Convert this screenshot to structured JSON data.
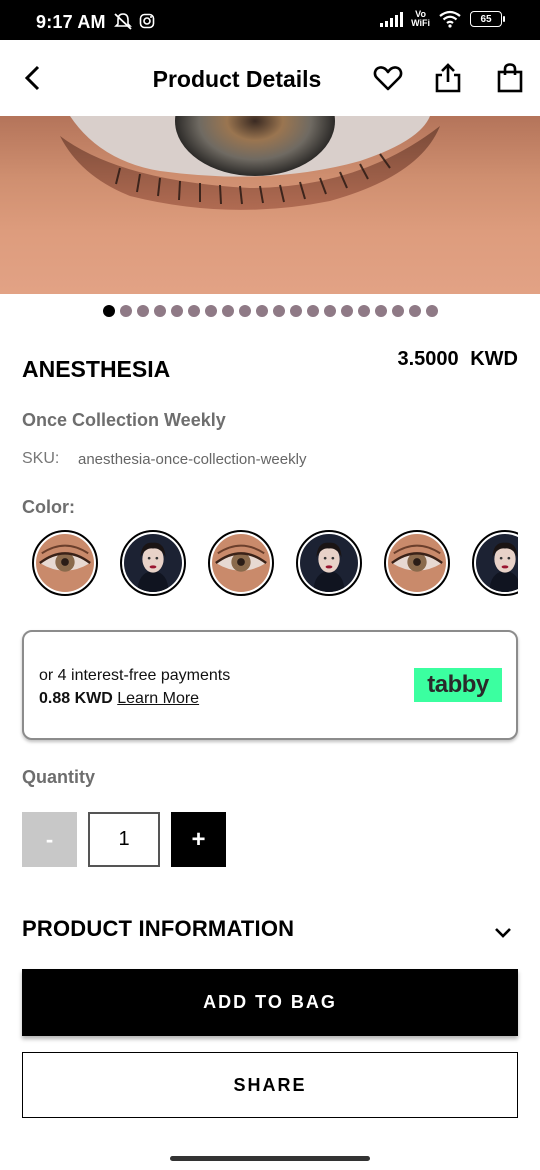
{
  "status_bar": {
    "time": "9:17 AM",
    "network_label_top": "Vo",
    "network_label_bottom": "WiFi",
    "battery": "65"
  },
  "header": {
    "title": "Product Details",
    "back_icon": "chevron-left-icon",
    "wishlist_icon": "heart-icon",
    "share_icon": "share-icon",
    "bag_icon": "shopping-bag-icon"
  },
  "gallery": {
    "total_images": 20,
    "active_index": 0
  },
  "product": {
    "name": "ANESTHESIA",
    "price": "3.5000 KWD",
    "collection": "Once Collection Weekly",
    "sku_label": "SKU:",
    "sku_value": "anesthesia-once-collection-weekly",
    "color_label": "Color:",
    "swatches": [
      "eye",
      "model",
      "eye",
      "model",
      "eye",
      "model"
    ]
  },
  "tabby": {
    "line1": "or 4 interest-free payments",
    "amount": "0.88 KWD",
    "learn_more": "Learn More",
    "logo_text": "tabby",
    "logo_color": "#3bffa0"
  },
  "quantity": {
    "label": "Quantity",
    "minus": "-",
    "value": "1",
    "plus": "+"
  },
  "product_info": {
    "title": "PRODUCT INFORMATION"
  },
  "actions": {
    "add_to_bag": "ADD TO BAG",
    "share": "SHARE"
  }
}
